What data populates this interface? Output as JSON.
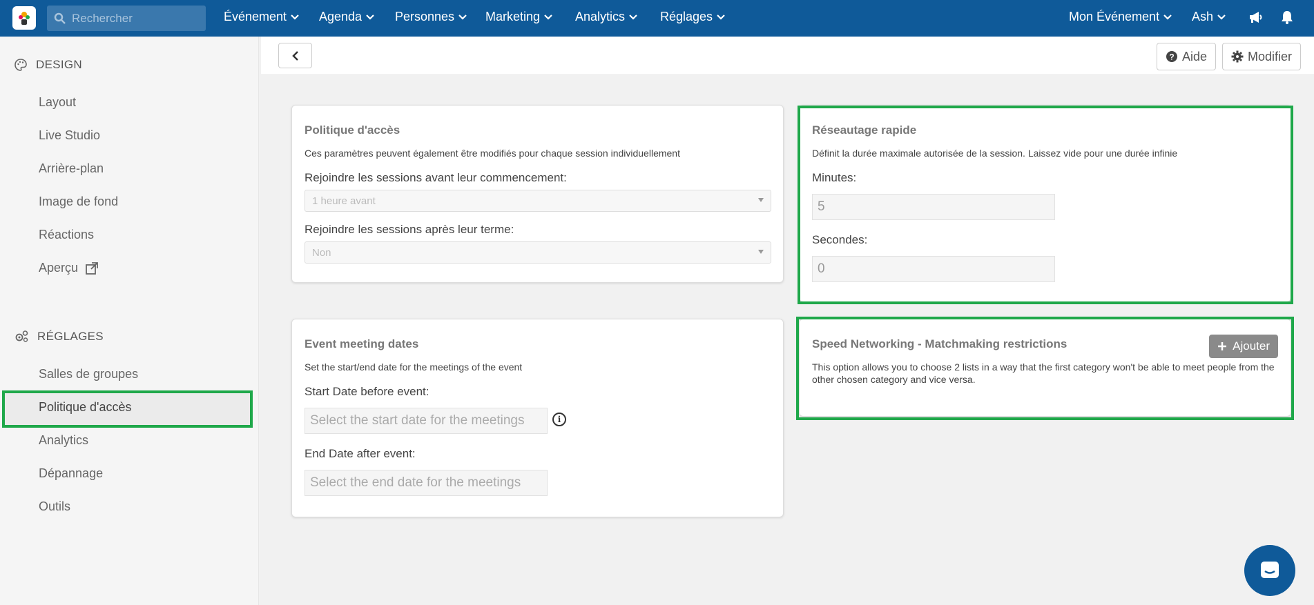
{
  "topbar": {
    "logo_icon": "app-logo-icon",
    "search": {
      "placeholder": "Rechercher"
    },
    "menus": [
      {
        "label": "Événement"
      },
      {
        "label": "Agenda"
      },
      {
        "label": "Personnes"
      },
      {
        "label": "Marketing"
      },
      {
        "label": "Analytics"
      },
      {
        "label": "Réglages"
      }
    ],
    "event_switcher": "Mon Événement",
    "user": "Ash",
    "icons": [
      "megaphone-icon",
      "bell-icon"
    ],
    "bg_color": "#0f5a99"
  },
  "sidebar": {
    "design_title": "DESIGN",
    "design_items": [
      {
        "label": "Layout"
      },
      {
        "label": "Live Studio"
      },
      {
        "label": "Arrière-plan"
      },
      {
        "label": "Image de fond"
      },
      {
        "label": "Réactions"
      },
      {
        "label": "Aperçu"
      }
    ],
    "settings_title": "RÉGLAGES",
    "settings_items": [
      {
        "label": "Salles de groupes"
      },
      {
        "label": "Politique d'accès"
      },
      {
        "label": "Analytics"
      },
      {
        "label": "Dépannage"
      },
      {
        "label": "Outils"
      }
    ],
    "active_item": "Politique d'accès",
    "highlight_color": "#1fa84a"
  },
  "header": {
    "help_label": "Aide",
    "edit_label": "Modifier"
  },
  "access_policy": {
    "title": "Politique d'accès",
    "description": "Ces paramètres peuvent également être modifiés pour chaque session individuellement",
    "join_before_label": "Rejoindre les sessions avant leur commencement:",
    "join_before_value": "1 heure avant",
    "join_after_label": "Rejoindre les sessions après leur terme:",
    "join_after_value": "Non"
  },
  "speed_networking": {
    "title": "Réseautage rapide",
    "description": "Définit la durée maximale autorisée de la session. Laissez vide pour une durée infinie",
    "minutes_label": "Minutes:",
    "minutes_value": "5",
    "seconds_label": "Secondes:",
    "seconds_value": "0"
  },
  "meeting_dates": {
    "title": "Event meeting dates",
    "description": "Set the start/end date for the meetings of the event",
    "start_label": "Start Date before event:",
    "start_placeholder": "Select the start date for the meetings",
    "end_label": "End Date after event:",
    "end_placeholder": "Select the end date for the meetings"
  },
  "matchmaking": {
    "title": "Speed Networking - Matchmaking restrictions",
    "add_label": "Ajouter",
    "description": "This option allows you to choose 2 lists in a way that the first category won't be able to meet people from the other chosen category and vice versa."
  }
}
